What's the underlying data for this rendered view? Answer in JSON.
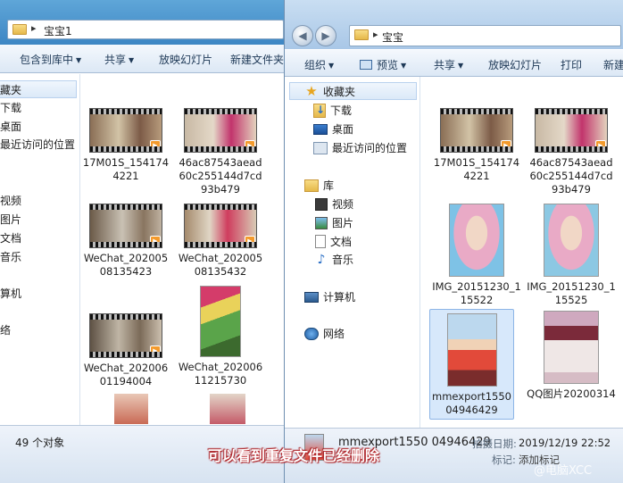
{
  "back_window": {
    "path": "宝宝1",
    "toolbar": [
      "包含到库中",
      "共享",
      "放映幻灯片",
      "新建文件夹"
    ],
    "nav": [
      "藏夹",
      "下载",
      "桌面",
      "最近访问的位置",
      "视频",
      "图片",
      "文档",
      "音乐",
      "算机",
      "络"
    ],
    "items": [
      {
        "caption": "17M01S_1541744221",
        "kind": "video"
      },
      {
        "caption": "46ac87543aead60c255144d7cd93b479",
        "kind": "video"
      },
      {
        "caption": "WeChat_20200508135423",
        "kind": "video"
      },
      {
        "caption": "WeChat_20200508135432",
        "kind": "video"
      },
      {
        "caption": "WeChat_20200601194004",
        "kind": "video"
      },
      {
        "caption": "WeChat_20200611215730",
        "kind": "photo"
      }
    ],
    "status": "49 个对象"
  },
  "front_window": {
    "path": "宝宝",
    "toolbar": [
      "组织",
      "预览",
      "共享",
      "放映幻灯片",
      "打印",
      "新建"
    ],
    "nav": {
      "favorites": "收藏夹",
      "downloads": "下载",
      "desktop": "桌面",
      "recent": "最近访问的位置",
      "library": "库",
      "videos": "视频",
      "pictures": "图片",
      "documents": "文档",
      "music": "音乐",
      "computer": "计算机",
      "network": "网络"
    },
    "items": [
      {
        "caption": "17M01S_1541744221",
        "kind": "video"
      },
      {
        "caption": "46ac87543aead60c255144d7cd93b479",
        "kind": "video"
      },
      {
        "caption": "IMG_20151230_115522",
        "kind": "photo"
      },
      {
        "caption": "IMG_20151230_115525",
        "kind": "photo"
      },
      {
        "caption": "mmexport1550 04946429",
        "kind": "photo",
        "selected": true
      },
      {
        "caption": "QQ图片20200314",
        "kind": "photo"
      }
    ],
    "details": {
      "filename": "mmexport1550 04946429",
      "date_label": "拍摄日期:",
      "date_value": "2019/12/19 22:52",
      "tags_label": "标记:",
      "tags_value": "添加标记"
    }
  },
  "overlay": {
    "caption": "可以看到重复文件已经删除",
    "watermark": "@电脑XCC"
  },
  "colors": {
    "accent": "#1f6fc0",
    "selection": "#d7e8fb",
    "caption_outline": "#c0262b"
  }
}
